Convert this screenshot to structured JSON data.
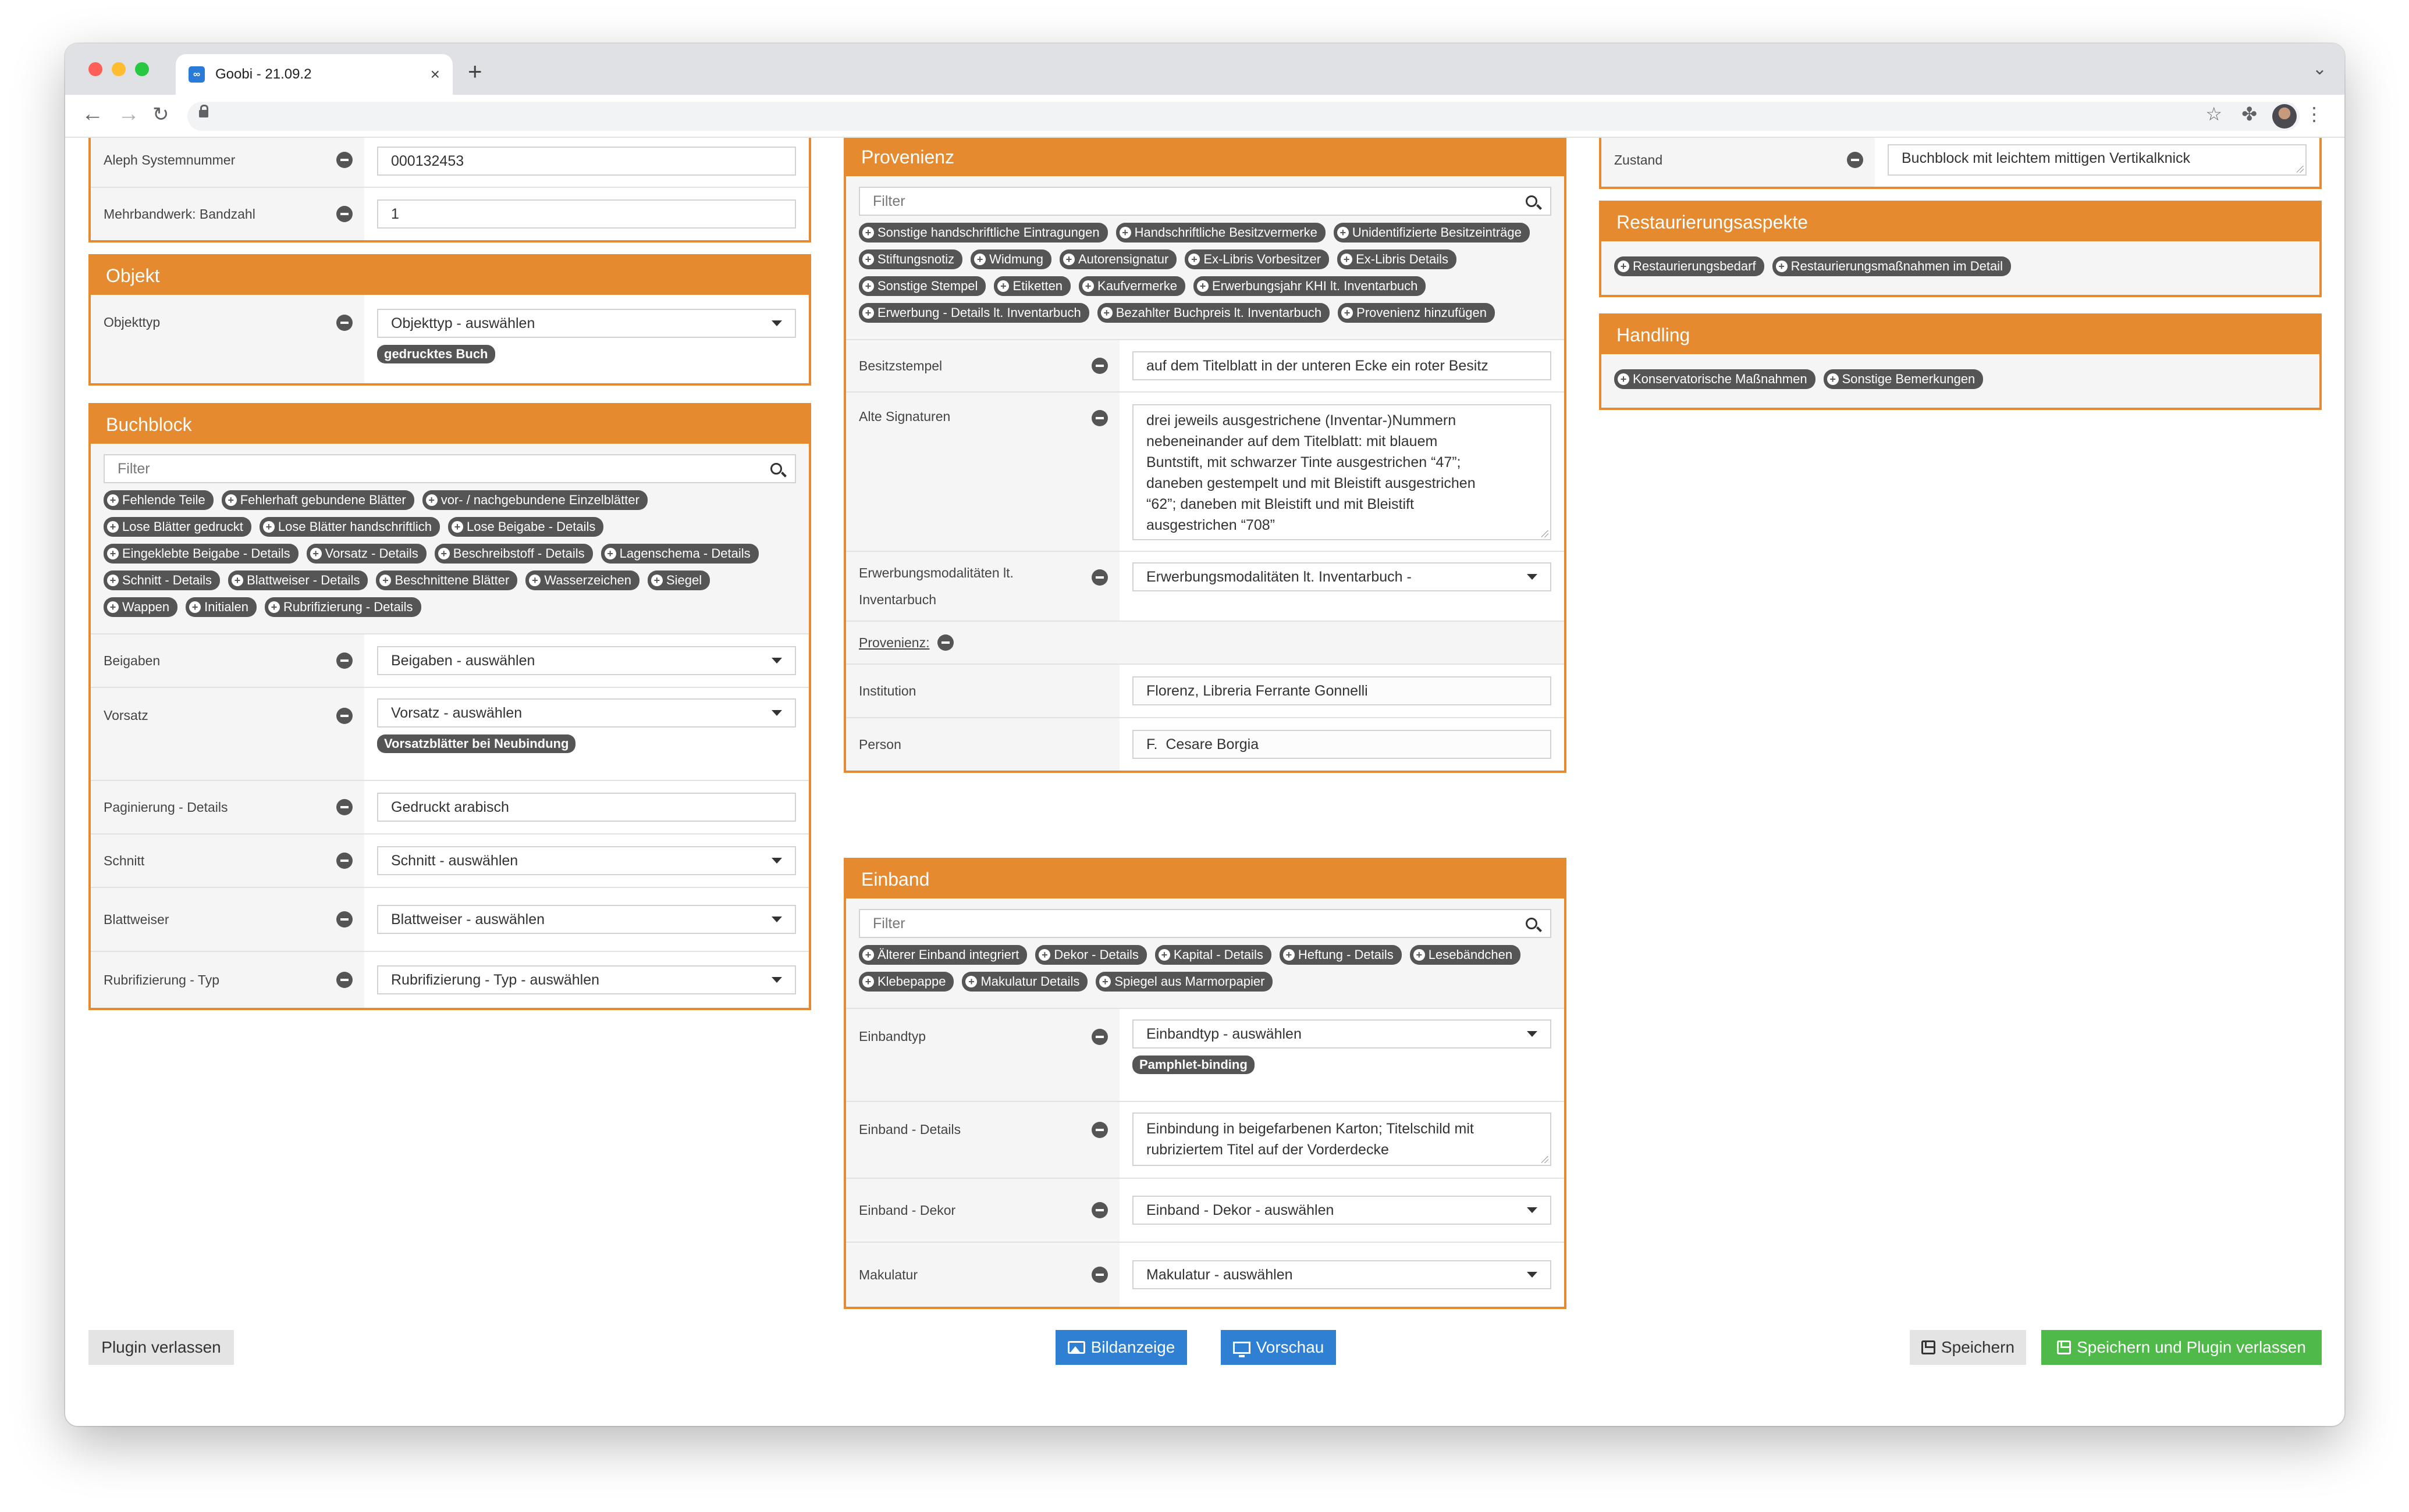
{
  "browser": {
    "tab_title": "Goobi - 21.09.2",
    "favicon_text": "∞",
    "new_tab": "+",
    "tab_close": "×"
  },
  "colors": {
    "accent": "#e58a2e",
    "primary": "#2f7fd3",
    "success": "#4fb94a",
    "chip": "#555555"
  },
  "left": {
    "top_rows": [
      {
        "label": "Aleph Systemnummer",
        "value": "000132453"
      },
      {
        "label": "Mehrbandwerk: Bandzahl",
        "value": "1"
      }
    ],
    "objekt": {
      "title": "Objekt",
      "row_label": "Objekttyp",
      "select": "Objekttyp - auswählen",
      "chip": "gedrucktes Buch"
    },
    "buchblock": {
      "title": "Buchblock",
      "filter_placeholder": "Filter",
      "chips": [
        "Fehlende Teile",
        "Fehlerhaft gebundene Blätter",
        "vor- / nachgebundene Einzelblätter",
        "Lose Blätter gedruckt",
        "Lose Blätter handschriftlich",
        "Lose Beigabe - Details",
        "Eingeklebte Beigabe - Details",
        "Vorsatz - Details",
        "Beschreibstoff - Details",
        "Lagenschema - Details",
        "Schnitt - Details",
        "Blattweiser - Details",
        "Beschnittene Blätter",
        "Wasserzeichen",
        "Siegel",
        "Wappen",
        "Initialen",
        "Rubrifizierung - Details"
      ],
      "beigaben_label": "Beigaben",
      "beigaben_select": "Beigaben - auswählen",
      "vorsatz_label": "Vorsatz",
      "vorsatz_select": "Vorsatz - auswählen",
      "vorsatz_chip": "Vorsatzblätter bei Neubindung",
      "paginierung_label": "Paginierung - Details",
      "paginierung_value": "Gedruckt arabisch",
      "schnitt_label": "Schnitt",
      "schnitt_select": "Schnitt - auswählen",
      "blattweiser_label": "Blattweiser",
      "blattweiser_select": "Blattweiser - auswählen",
      "rubrifizierung_label": "Rubrifizierung - Typ",
      "rubrifizierung_select": "Rubrifizierung - Typ - auswählen"
    }
  },
  "middle": {
    "provenienz": {
      "title": "Provenienz",
      "filter_placeholder": "Filter",
      "chips": [
        "Sonstige handschriftliche Eintragungen",
        "Handschriftliche Besitzvermerke",
        "Unidentifizierte Besitzeinträge",
        "Stiftungsnotiz",
        "Widmung",
        "Autorensignatur",
        "Ex-Libris Vorbesitzer",
        "Ex-Libris Details",
        "Sonstige Stempel",
        "Etiketten",
        "Kaufvermerke",
        "Erwerbungsjahr KHI lt. Inventarbuch",
        "Erwerbung - Details lt. Inventarbuch",
        "Bezahlter Buchpreis lt. Inventarbuch",
        "Provenienz hinzufügen"
      ],
      "besitzstempel_label": "Besitzstempel",
      "besitzstempel_value": "auf dem Titelblatt in der unteren Ecke ein roter Besitz",
      "alte_signaturen_label": "Alte Signaturen",
      "alte_signaturen_lines": [
        "drei jeweils ausgestrichene (Inventar-)Nummern",
        "nebeneinander auf dem Titelblatt: mit blauem",
        "Buntstift, mit schwarzer Tinte ausgestrichen “47”;",
        "daneben gestempelt und mit Bleistift ausgestrichen",
        "“62”; daneben mit Bleistift und mit Bleistift",
        "ausgestrichen “708”"
      ],
      "erwerbung_label_1": "Erwerbungsmodalitäten lt.",
      "erwerbung_label_2": "Inventarbuch",
      "erwerbung_select": "Erwerbungsmodalitäten lt. Inventarbuch -",
      "provenienz_link": "Provenienz:",
      "institution_label": "Institution",
      "institution_value": "Florenz, Libreria Ferrante Gonnelli",
      "person_label": "Person",
      "person_value": "F.  Cesare Borgia"
    },
    "einband": {
      "title": "Einband",
      "filter_placeholder": "Filter",
      "chips": [
        "Älterer Einband integriert",
        "Dekor - Details",
        "Kapital - Details",
        "Heftung - Details",
        "Lesebändchen",
        "Klebepappe",
        "Makulatur Details",
        "Spiegel aus Marmorpapier"
      ],
      "einbandtyp_label": "Einbandtyp",
      "einbandtyp_select": "Einbandtyp - auswählen",
      "einbandtyp_chip": "Pamphlet-binding",
      "details_label": "Einband - Details",
      "details_lines": [
        "Einbindung in beigefarbenen Karton; Titelschild mit",
        "rubriziertem Titel auf der Vorderdecke"
      ],
      "dekor_label": "Einband - Dekor",
      "dekor_select": "Einband - Dekor - auswählen",
      "makulatur_label": "Makulatur",
      "makulatur_select": "Makulatur - auswählen"
    }
  },
  "right": {
    "zustand_label": "Zustand",
    "zustand_value": "Buchblock mit leichtem mittigen Vertikalknick",
    "restaurierung": {
      "title": "Restaurierungsaspekte",
      "chips": [
        "Restaurierungsbedarf",
        "Restaurierungsmaßnahmen im Detail"
      ]
    },
    "handling": {
      "title": "Handling",
      "chips": [
        "Konservatorische Maßnahmen",
        "Sonstige Bemerkungen"
      ]
    }
  },
  "footer": {
    "leave_label": "Plugin verlassen",
    "image_label": "Bildanzeige",
    "preview_label": "Vorschau",
    "save_label": "Speichern",
    "save_leave_label": "Speichern und Plugin verlassen"
  }
}
